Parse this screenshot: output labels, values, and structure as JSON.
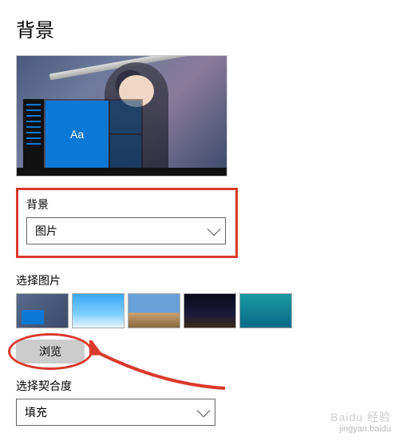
{
  "page_title": "背景",
  "preview": {
    "sample_text": "Aa"
  },
  "background_section": {
    "label": "背景",
    "selected": "图片"
  },
  "choose_picture": {
    "label": "选择图片",
    "browse_label": "浏览"
  },
  "fit_section": {
    "label": "选择契合度",
    "selected": "填充"
  },
  "annotation": {
    "color": "#d93a2b"
  },
  "watermark": {
    "brand": "Baidu 经验",
    "id": "jingyan.baidu"
  }
}
